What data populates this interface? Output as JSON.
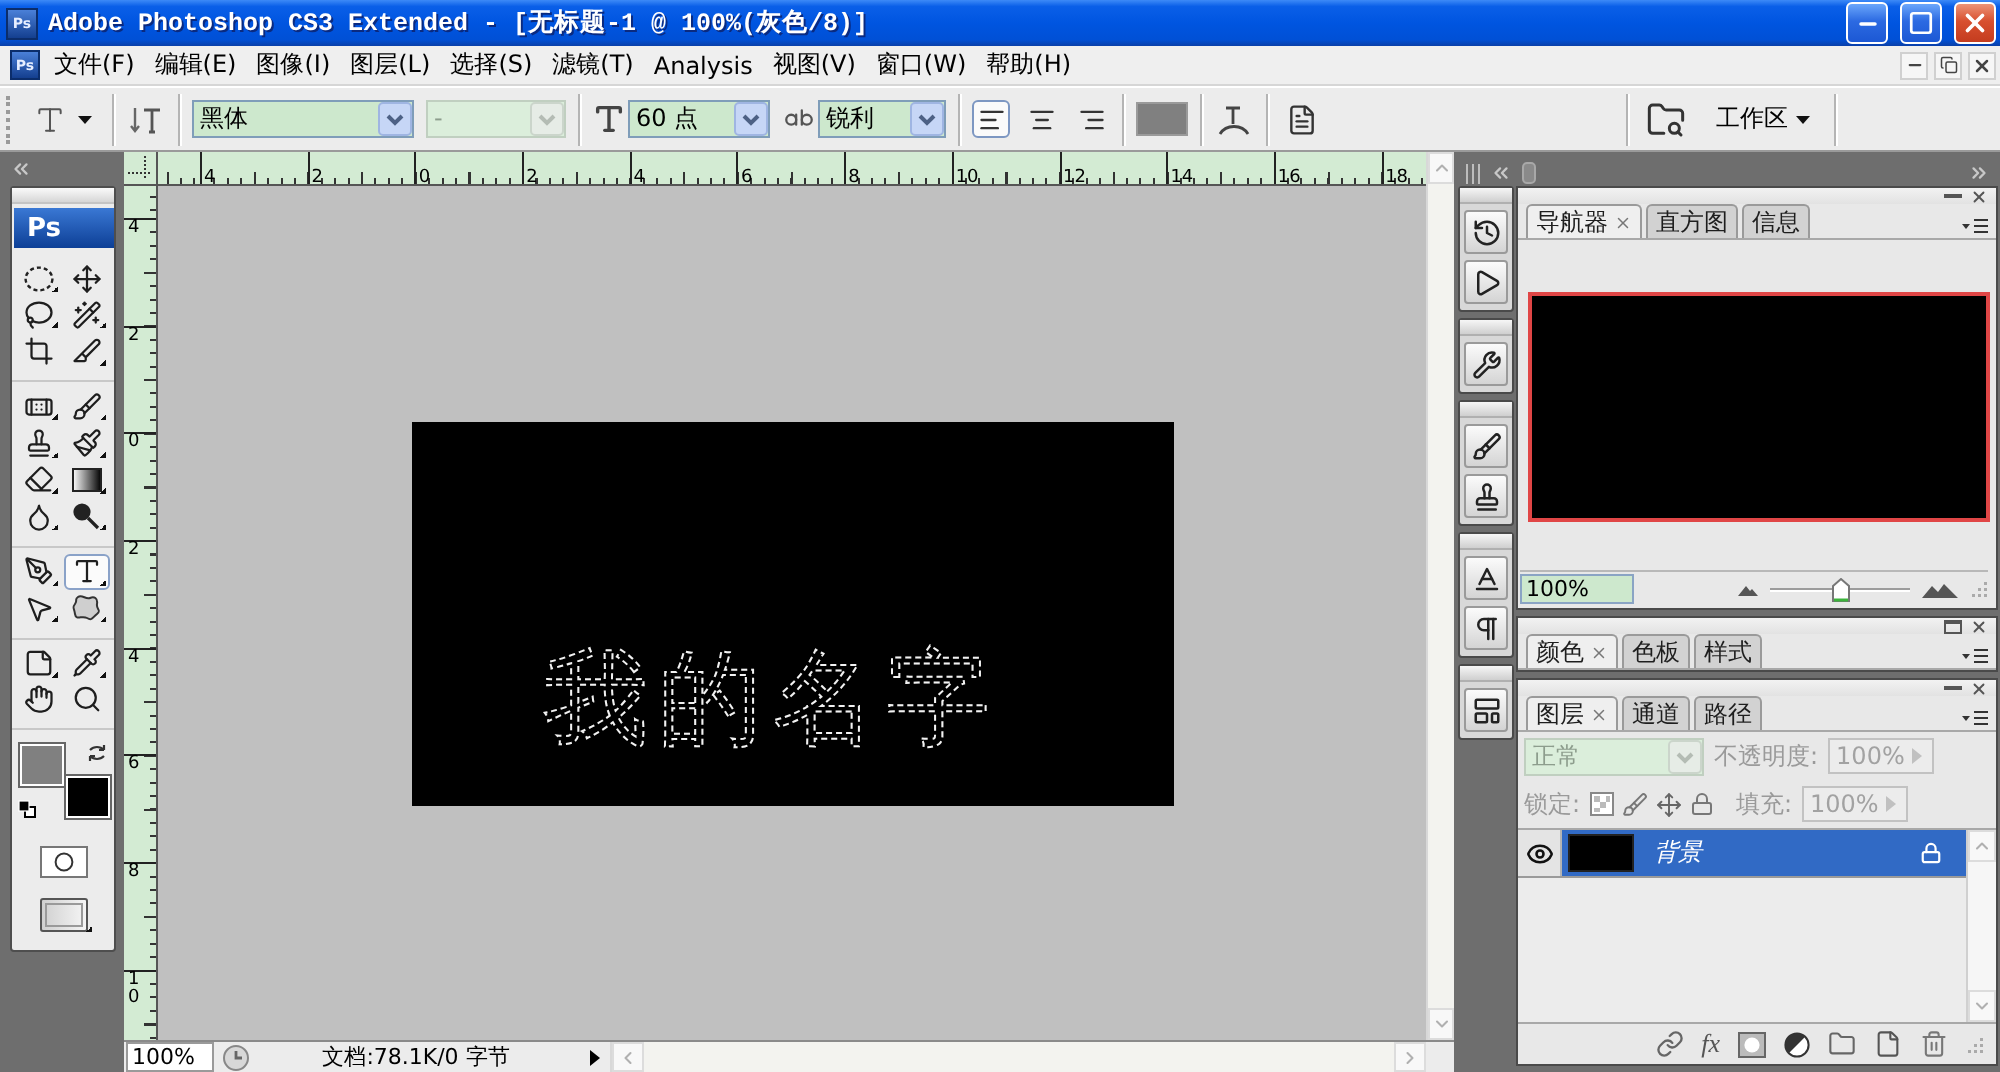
{
  "title_bar": {
    "logo": "Ps",
    "title": "Adobe Photoshop CS3 Extended - [无标题-1 @ 100%(灰色/8)]"
  },
  "menu_bar": {
    "logo": "Ps",
    "items": [
      "文件(F)",
      "编辑(E)",
      "图像(I)",
      "图层(L)",
      "选择(S)",
      "滤镜(T)",
      "Analysis",
      "视图(V)",
      "窗口(W)",
      "帮助(H)"
    ]
  },
  "options_bar": {
    "font_family": {
      "value": "黑体",
      "disabled": false
    },
    "font_style": {
      "value": "-",
      "disabled": true
    },
    "font_size": {
      "value": "60 点",
      "disabled": false
    },
    "anti_alias": {
      "value": "锐利",
      "disabled": false
    },
    "align": [
      {
        "kind": "left",
        "selected": true
      },
      {
        "kind": "center",
        "selected": false
      },
      {
        "kind": "right",
        "selected": false
      }
    ],
    "text_color": {
      "color": "#808080"
    },
    "workspace": "工作区"
  },
  "toolbox": {
    "logo": "Ps",
    "tool_groups": [
      [
        {
          "kind": "marquee",
          "flyout": true,
          "selected": false
        },
        {
          "kind": "move",
          "flyout": false,
          "selected": false
        },
        {
          "kind": "lasso",
          "flyout": true,
          "selected": false
        },
        {
          "kind": "wand",
          "flyout": true,
          "selected": false
        },
        {
          "kind": "crop",
          "flyout": false,
          "selected": false
        },
        {
          "kind": "slice",
          "flyout": true,
          "selected": false
        }
      ],
      [
        {
          "kind": "healing",
          "flyout": true,
          "selected": false
        },
        {
          "kind": "brush",
          "flyout": true,
          "selected": false
        },
        {
          "kind": "stamp",
          "flyout": true,
          "selected": false
        },
        {
          "kind": "historybrush",
          "flyout": true,
          "selected": false
        },
        {
          "kind": "eraser",
          "flyout": true,
          "selected": false
        },
        {
          "kind": "gradient",
          "flyout": true,
          "selected": false
        },
        {
          "kind": "blur",
          "flyout": true,
          "selected": false
        },
        {
          "kind": "dodge",
          "flyout": true,
          "selected": false
        }
      ],
      [
        {
          "kind": "pen",
          "flyout": true,
          "selected": false
        },
        {
          "kind": "type",
          "flyout": true,
          "selected": true
        },
        {
          "kind": "pathselect",
          "flyout": true,
          "selected": false
        },
        {
          "kind": "shape",
          "flyout": true,
          "selected": false
        }
      ],
      [
        {
          "kind": "notes",
          "flyout": true,
          "selected": false
        },
        {
          "kind": "eyedropper",
          "flyout": true,
          "selected": false
        },
        {
          "kind": "hand",
          "flyout": false,
          "selected": false
        },
        {
          "kind": "zoom",
          "flyout": false,
          "selected": false
        }
      ]
    ],
    "foreground": {
      "color": "#808080"
    },
    "background": {
      "color": "#000000"
    }
  },
  "document": {
    "top_ruler": [
      "4",
      "2",
      "0",
      "2",
      "4",
      "6",
      "8",
      "10",
      "12",
      "14",
      "16",
      "18"
    ],
    "left_ruler": [
      "4",
      "2",
      "0",
      "2",
      "4",
      "6",
      "8",
      "10"
    ],
    "canvas_text": "我的名字",
    "status_bar": {
      "zoom": "100%",
      "info": "文档:78.1K/0 字节"
    }
  },
  "panels": [
    {
      "kind": "navigator",
      "collapsed": false,
      "tabs": [
        {
          "label": "导航器",
          "selected": true
        },
        {
          "label": "直方图",
          "selected": false
        },
        {
          "label": "信息",
          "selected": false
        }
      ],
      "zoom": "100%",
      "zoom_slider": {
        "level": 0.5
      }
    },
    {
      "kind": "color",
      "collapsed": true,
      "tabs": [
        {
          "label": "颜色",
          "selected": true
        },
        {
          "label": "色板",
          "selected": false
        },
        {
          "label": "样式",
          "selected": false
        }
      ]
    },
    {
      "kind": "layers",
      "collapsed": false,
      "tabs": [
        {
          "label": "图层",
          "selected": true
        },
        {
          "label": "通道",
          "selected": false
        },
        {
          "label": "路径",
          "selected": false
        }
      ],
      "blend_mode": {
        "value": "正常",
        "disabled": true
      },
      "opacity": {
        "label": "不透明度:",
        "value": "100%",
        "disabled": true
      },
      "lock_label": "锁定:",
      "fill": {
        "label": "填充:",
        "value": "100%",
        "disabled": true
      },
      "layers": [
        {
          "name": "背景",
          "visible": true,
          "selected": true,
          "locked": true
        }
      ],
      "effects_button": "fx"
    }
  ]
}
